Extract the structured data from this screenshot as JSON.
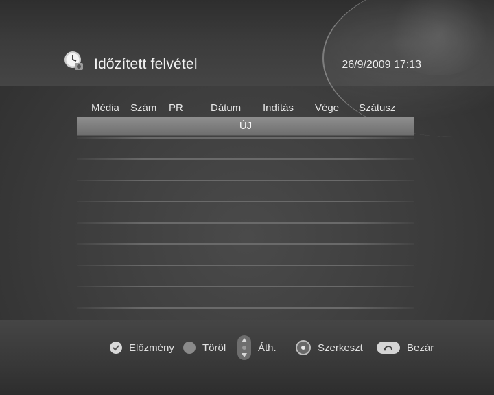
{
  "header": {
    "title": "Időzített felvétel",
    "datetime": "26/9/2009 17:13",
    "icon": "clock-icon"
  },
  "table": {
    "columns": [
      "Média",
      "Szám",
      "PR",
      "Dátum",
      "Indítás",
      "Vége",
      "Szátusz"
    ],
    "new_entry_label": "ÚJ",
    "empty_rows": 8
  },
  "legend": {
    "items": [
      {
        "icon": "check-icon",
        "label": "Előzmény"
      },
      {
        "icon": "gray-dot-icon",
        "label": "Töröl"
      },
      {
        "icon": "arrows-icon",
        "label": "Áth."
      },
      {
        "icon": "enter-icon",
        "label": "Szerkeszt"
      },
      {
        "icon": "return-icon",
        "label": "Bezár"
      }
    ]
  }
}
